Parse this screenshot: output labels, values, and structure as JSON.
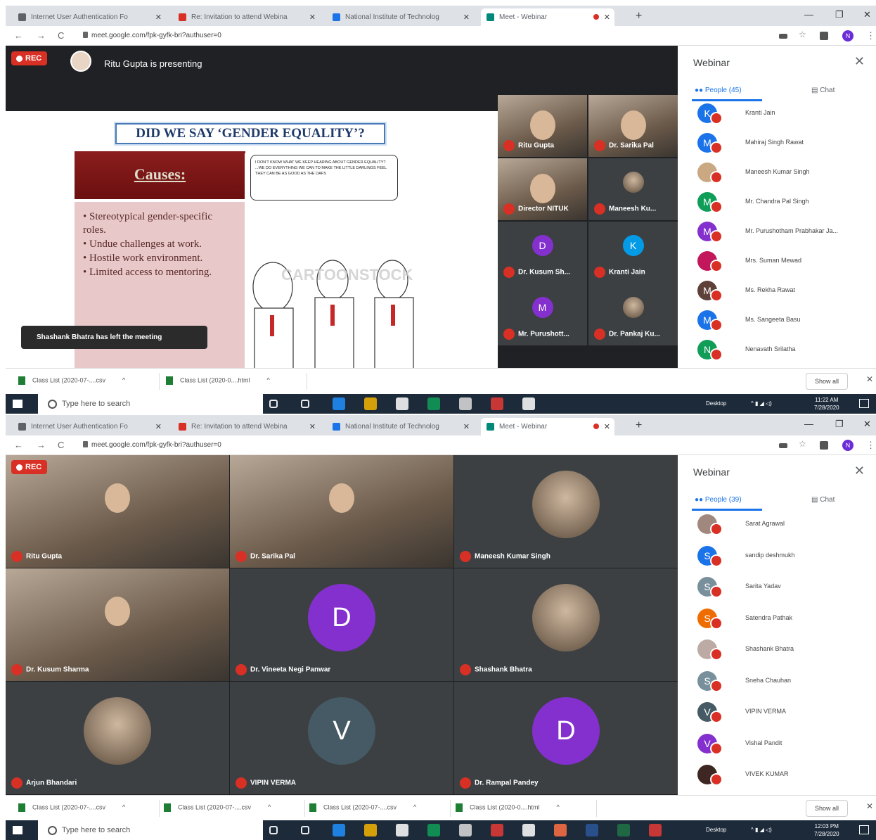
{
  "screens": [
    {
      "tabs": [
        {
          "label": "Internet User Authentication Fo",
          "color": "#5f6368"
        },
        {
          "label": "Re: Invitation to attend Webina",
          "color": "#d93025"
        },
        {
          "label": "National Institute of Technolog",
          "color": "#1a73e8"
        },
        {
          "label": "Meet - Webinar",
          "color": "#00897b"
        }
      ],
      "url": "meet.google.com/fpk-gyfk-bri?authuser=0",
      "profile": "N",
      "rec": "REC",
      "presenter_text": "Ritu Gupta is presenting",
      "slide": {
        "title": "DID WE SAY ‘GENDER EQUALITY’?",
        "causes": "Causes:",
        "bullets": [
          "Stereotypical gender-specific roles.",
          "Undue challenges at work.",
          "Hostile work environment.",
          "Limited access to mentoring."
        ],
        "bubble": "I DON'T KNOW WHAT WE KEEP HEARING ABOUT GENDER EQUALITY? ...WE DO EVERYTHING WE CAN TO MAKE THE LITTLE DARLINGS FEEL THEY CAN BE AS GOOD AS THE OAFS",
        "watermark": "CARTOONSTOCK"
      },
      "toast": "Shashank Bhatra has left the meeting",
      "tiles": [
        {
          "name": "Ritu Gupta",
          "initial": "",
          "color": ""
        },
        {
          "name": "Dr. Sarika Pal",
          "initial": "",
          "color": ""
        },
        {
          "name": "Director NITUK",
          "initial": "",
          "color": ""
        },
        {
          "name": "Maneesh Ku...",
          "initial": "",
          "color": ""
        },
        {
          "name": "Dr. Kusum Sh...",
          "initial": "D",
          "color": "#8430ce"
        },
        {
          "name": "Kranti Jain",
          "initial": "K",
          "color": "#039be5"
        },
        {
          "name": "Mr. Purushott...",
          "initial": "M",
          "color": "#8430ce"
        },
        {
          "name": "Dr. Pankaj Ku...",
          "initial": "",
          "color": ""
        }
      ],
      "sidebar": {
        "title": "Webinar",
        "people_tab": "People (45)",
        "chat_tab": "Chat",
        "people": [
          {
            "name": "Kranti Jain",
            "initial": "K",
            "color": "#1a73e8"
          },
          {
            "name": "Mahiraj Singh Rawat",
            "initial": "M",
            "color": "#1a73e8"
          },
          {
            "name": "Maneesh Kumar Singh",
            "initial": "",
            "color": "#c9a882"
          },
          {
            "name": "Mr. Chandra Pal Singh",
            "initial": "M",
            "color": "#0f9d58"
          },
          {
            "name": "Mr. Purushotham Prabhakar Ja...",
            "initial": "M",
            "color": "#8430ce"
          },
          {
            "name": "Mrs. Suman Mewad",
            "initial": "",
            "color": "#c2185b"
          },
          {
            "name": "Ms. Rekha Rawat",
            "initial": "M",
            "color": "#5d4037"
          },
          {
            "name": "Ms. Sangeeta Basu",
            "initial": "M",
            "color": "#1a73e8"
          },
          {
            "name": "Nenavath Srilatha",
            "initial": "N",
            "color": "#0f9d58"
          }
        ]
      },
      "downloads": [
        "Class List (2020-07-....csv",
        "Class List (2020-0....html"
      ],
      "show_all": "Show all",
      "taskbar": {
        "search": "Type here to search",
        "desktop": "Desktop",
        "time": "11:22 AM",
        "date": "7/28/2020"
      }
    },
    {
      "tabs": [
        {
          "label": "Internet User Authentication Fo",
          "color": "#5f6368"
        },
        {
          "label": "Re: Invitation to attend Webina",
          "color": "#d93025"
        },
        {
          "label": "National Institute of Technolog",
          "color": "#1a73e8"
        },
        {
          "label": "Meet - Webinar",
          "color": "#00897b"
        }
      ],
      "url": "meet.google.com/fpk-gyfk-bri?authuser=0",
      "profile": "N",
      "rec": "REC",
      "tiles": [
        {
          "name": "Ritu Gupta",
          "initial": "",
          "color": ""
        },
        {
          "name": "Dr. Sarika Pal",
          "initial": "",
          "color": ""
        },
        {
          "name": "Maneesh Kumar Singh",
          "initial": "",
          "color": ""
        },
        {
          "name": "Dr. Kusum Sharma",
          "initial": "",
          "color": ""
        },
        {
          "name": "Dr. Vineeta Negi Panwar",
          "initial": "D",
          "color": "#8430ce"
        },
        {
          "name": "Shashank Bhatra",
          "initial": "",
          "color": ""
        },
        {
          "name": "Arjun Bhandari",
          "initial": "",
          "color": ""
        },
        {
          "name": "VIPIN VERMA",
          "initial": "V",
          "color": "#455a64"
        },
        {
          "name": "Dr. Rampal Pandey",
          "initial": "D",
          "color": "#8430ce"
        }
      ],
      "sidebar": {
        "title": "Webinar",
        "people_tab": "People (39)",
        "chat_tab": "Chat",
        "people": [
          {
            "name": "Sarat Agrawal",
            "initial": "",
            "color": "#a1887f"
          },
          {
            "name": "sandip deshmukh",
            "initial": "S",
            "color": "#1a73e8"
          },
          {
            "name": "Sarita Yadav",
            "initial": "S",
            "color": "#78909c"
          },
          {
            "name": "Satendra Pathak",
            "initial": "S",
            "color": "#ef6c00"
          },
          {
            "name": "Shashank Bhatra",
            "initial": "",
            "color": "#bcaaa4"
          },
          {
            "name": "Sneha Chauhan",
            "initial": "S",
            "color": "#78909c"
          },
          {
            "name": "VIPIN VERMA",
            "initial": "V",
            "color": "#455a64"
          },
          {
            "name": "Vishal Pandit",
            "initial": "V",
            "color": "#8430ce"
          },
          {
            "name": "VIVEK KUMAR",
            "initial": "",
            "color": "#3e2723"
          }
        ]
      },
      "downloads": [
        "Class List (2020-07-....csv",
        "Class List (2020-07-....csv",
        "Class List (2020-07-....csv",
        "Class List (2020-0....html"
      ],
      "show_all": "Show all",
      "taskbar": {
        "search": "Type here to search",
        "desktop": "Desktop",
        "time": "12:03 PM",
        "date": "7/28/2020"
      }
    }
  ],
  "colors": {
    "meet_bg": "#202124",
    "tile_bg": "#3c4043",
    "rec_red": "#d93025",
    "taskbar": "#1c2a3a",
    "accent": "#1a73e8"
  }
}
